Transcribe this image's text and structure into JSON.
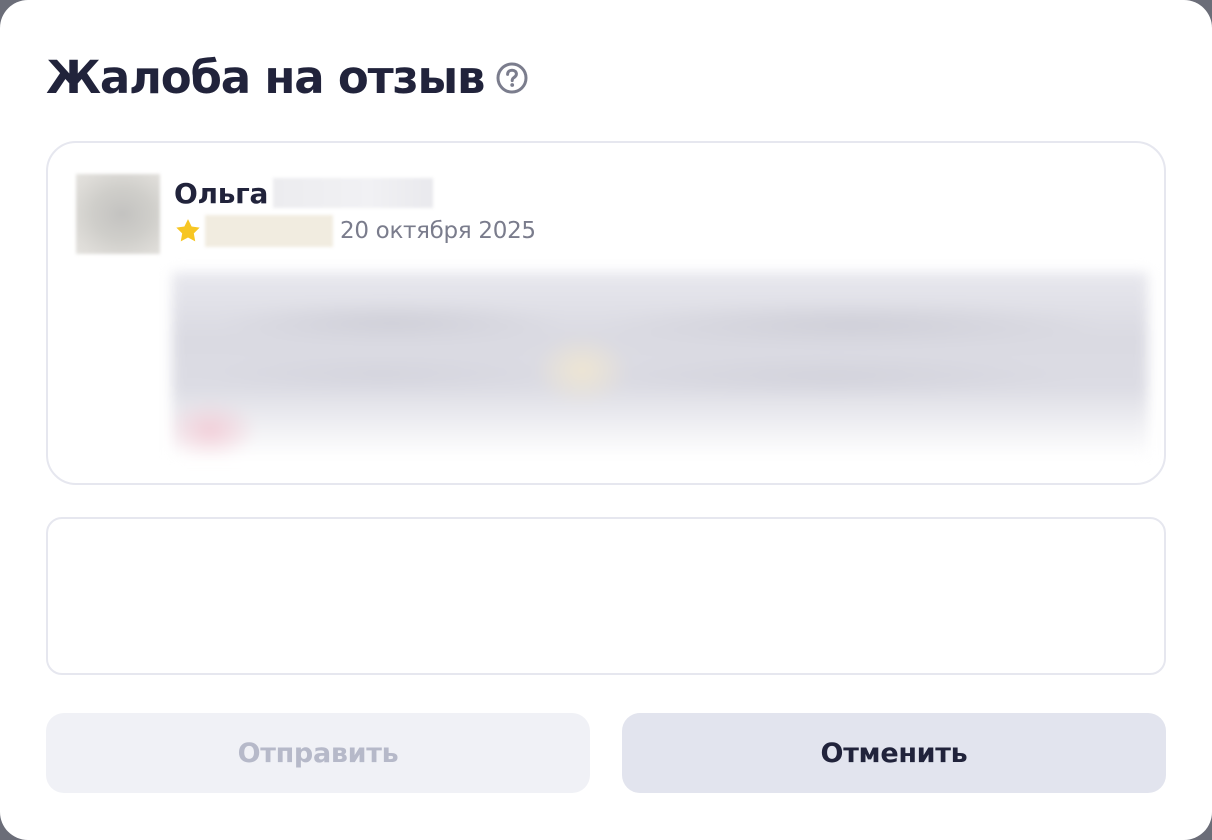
{
  "dialog": {
    "title": "Жалоба на отзыв",
    "help_icon": "question-circle-icon"
  },
  "review": {
    "author_first_name": "Ольга",
    "rating_icon": "star-icon",
    "date": "20 октября 2025"
  },
  "complaint": {
    "value": "",
    "placeholder": ""
  },
  "actions": {
    "send_label": "Отправить",
    "cancel_label": "Отменить"
  },
  "colors": {
    "title": "#21233b",
    "star": "#f7c623",
    "send_button_bg": "#f0f1f6",
    "send_button_text": "#b6b9c9",
    "cancel_button_bg": "#e2e4ee",
    "border": "#e6e7ef"
  }
}
